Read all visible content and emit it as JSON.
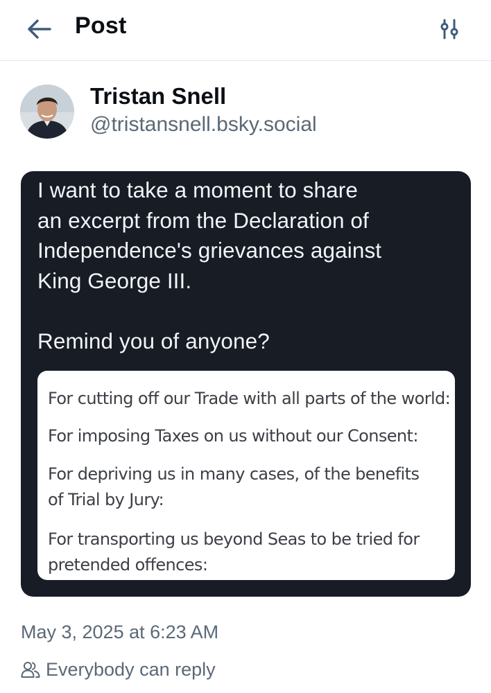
{
  "header": {
    "title": "Post"
  },
  "author": {
    "name": "Tristan Snell",
    "handle": "@tristansnell.bsky.social"
  },
  "post": {
    "image_text": "I want to take a moment to share\nan excerpt from the Declaration of\nIndependence's grievances against\nKing George III.\n\nRemind you of anyone?",
    "quotes": [
      "For cutting off our Trade with all parts of the world:",
      "For imposing Taxes on us without our Consent:",
      "For depriving us in many cases, of the benefits of Trial by Jury:",
      "For transporting us beyond Seas to be tried for pretended offences:"
    ],
    "timestamp": "May 3, 2025 at 6:23 AM",
    "reply_setting": "Everybody can reply"
  },
  "colors": {
    "image_background": "#171c25",
    "muted_text": "#5b6875",
    "back_arrow": "#3e5c7a"
  },
  "icons": {
    "back": "arrow-left-icon",
    "settings": "sliders-icon",
    "reply_setting": "people-icon"
  }
}
